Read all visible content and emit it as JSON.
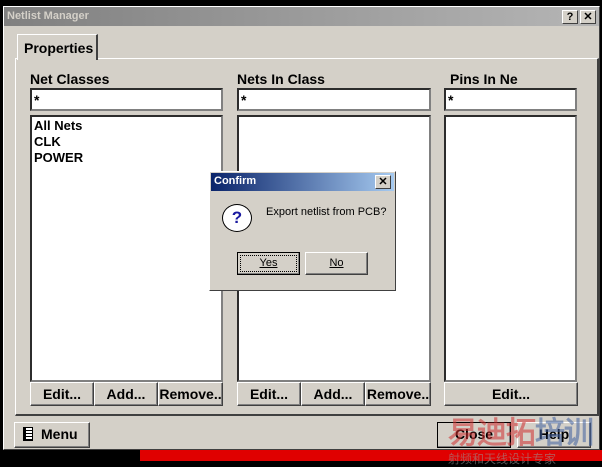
{
  "window": {
    "title": "Netlist Manager",
    "help_btn": "?",
    "close_btn": "✕"
  },
  "tab": {
    "label": "Properties"
  },
  "columns": [
    {
      "label": "Net Classes",
      "filter": "*",
      "items": [
        "All Nets",
        "CLK",
        "POWER"
      ],
      "buttons": [
        "Edit...",
        "Add...",
        "Remove.."
      ]
    },
    {
      "label": "Nets In Class",
      "filter": "*",
      "items": [],
      "buttons": [
        "Edit...",
        "Add...",
        "Remove.."
      ]
    },
    {
      "label": "Pins In Ne",
      "filter": "*",
      "items": [],
      "buttons": [
        "Edit..."
      ]
    }
  ],
  "footer": {
    "menu": "Menu",
    "close": "Close",
    "help": "Help"
  },
  "confirm": {
    "title": "Confirm",
    "message": "Export netlist from PCB?",
    "yes": "Yes",
    "no": "No",
    "close_btn": "✕"
  },
  "watermark": {
    "line1": "易迪拓培训",
    "line2": "射频和天线设计专家"
  }
}
